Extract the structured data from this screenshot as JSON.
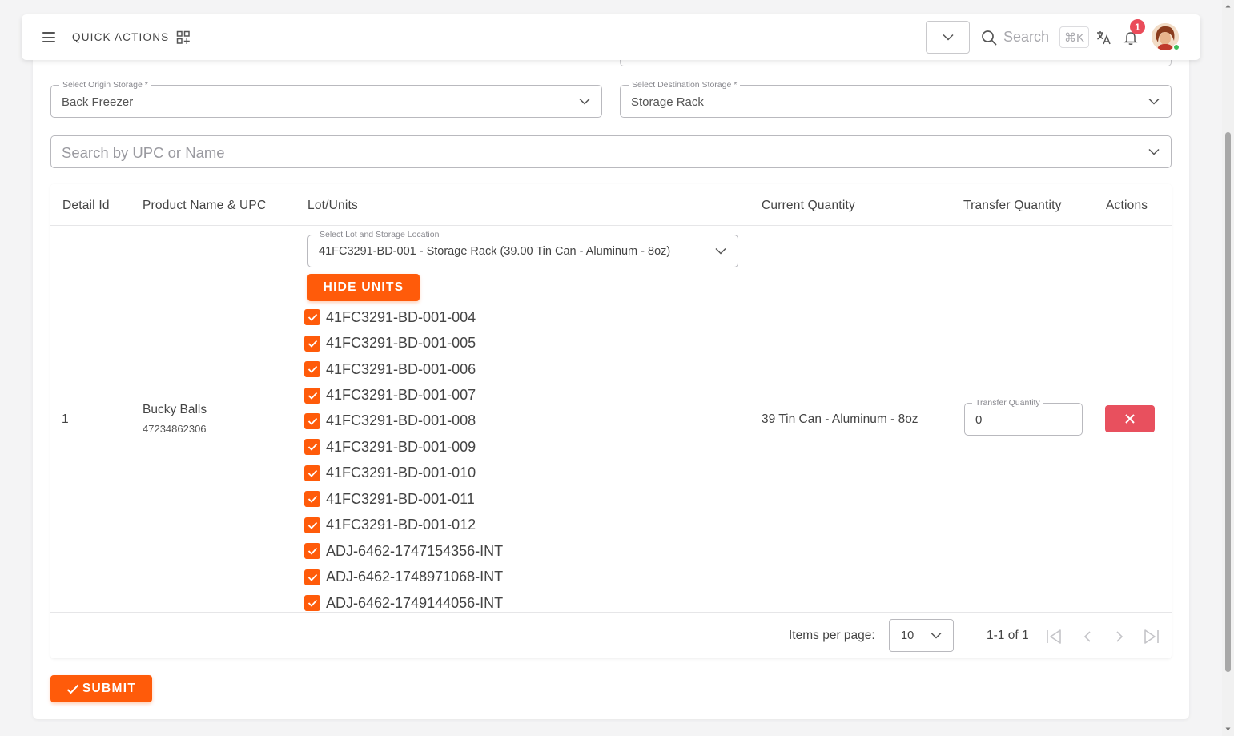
{
  "header": {
    "quick_actions_label": "QUICK ACTIONS",
    "search_placeholder": "Search",
    "search_shortcut": "⌘K",
    "notification_count": "1"
  },
  "form": {
    "origin_storage": {
      "label": "Select Origin Storage *",
      "value": "Back Freezer"
    },
    "destination_storage": {
      "label": "Select Destination Storage *",
      "value": "Storage Rack"
    },
    "product_search": {
      "placeholder": "Search by UPC or Name"
    }
  },
  "table": {
    "headers": {
      "detail_id": "Detail Id",
      "product": "Product Name & UPC",
      "lot_units": "Lot/Units",
      "current_quantity": "Current Quantity",
      "transfer_quantity": "Transfer Quantity",
      "actions": "Actions"
    },
    "row": {
      "detail_id": "1",
      "product_name": "Bucky Balls",
      "upc": "47234862306",
      "lot_select_label": "Select Lot and Storage Location",
      "lot_select_value": "41FC3291-BD-001 - Storage Rack (39.00 Tin Can - Aluminum - 8oz)",
      "hide_units_label": "HIDE UNITS",
      "units": [
        "41FC3291-BD-001-004",
        "41FC3291-BD-001-005",
        "41FC3291-BD-001-006",
        "41FC3291-BD-001-007",
        "41FC3291-BD-001-008",
        "41FC3291-BD-001-009",
        "41FC3291-BD-001-010",
        "41FC3291-BD-001-011",
        "41FC3291-BD-001-012",
        "ADJ-6462-1747154356-INT",
        "ADJ-6462-1748971068-INT",
        "ADJ-6462-1749144056-INT"
      ],
      "current_quantity": "39 Tin Can - Aluminum - 8oz",
      "transfer_quantity_label": "Transfer Quantity",
      "transfer_quantity_value": "0"
    },
    "pagination": {
      "items_per_page_label": "Items per page:",
      "items_per_page_value": "10",
      "range": "1-1 of 1"
    }
  },
  "submit_label": "SUBMIT",
  "colors": {
    "accent": "#ff5b0a",
    "danger": "#e8505e",
    "badge": "#ea4c5a"
  }
}
